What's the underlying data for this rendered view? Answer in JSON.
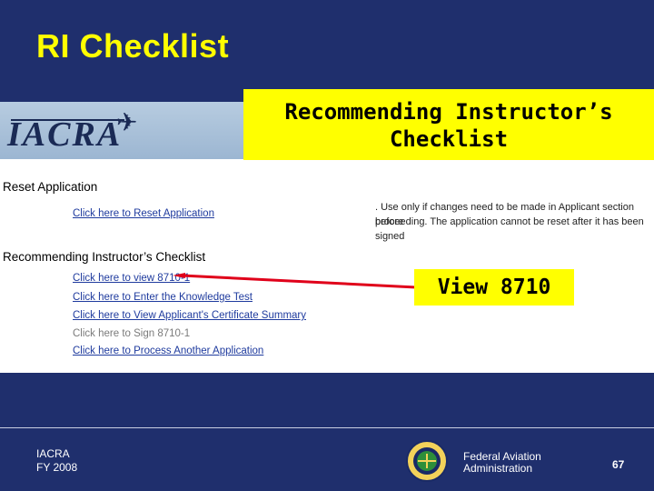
{
  "slide": {
    "title": "RI Checklist",
    "callout_title": "Recommending Instructor’s Checklist",
    "callout_view": "View 8710"
  },
  "screenshot": {
    "logo": "IACRA",
    "reset": {
      "title": "Reset Application",
      "link": "Click here to Reset Application",
      "note_line1": ". Use only if changes need to be made in Applicant section before",
      "note_line2": "proceeding. The application cannot be reset after it has been signed"
    },
    "checklist": {
      "title": "Recommending Instructor’s Checklist",
      "links": [
        "Click here to view 8710-1",
        "Click here to Enter the Knowledge Test",
        "Click here to View Applicant's Certificate Summary",
        "Click here to Sign 8710-1",
        "Click here to Process Another Application"
      ]
    }
  },
  "footer": {
    "line1": "IACRA",
    "line2": "FY 2008",
    "org_line1": "Federal Aviation",
    "org_line2": "Administration",
    "page_number": "67"
  },
  "colors": {
    "background": "#1f2f6d",
    "title": "#ffff00",
    "callout": "#ffff00",
    "arrow": "#e0001a",
    "link": "#1f3b9e"
  }
}
